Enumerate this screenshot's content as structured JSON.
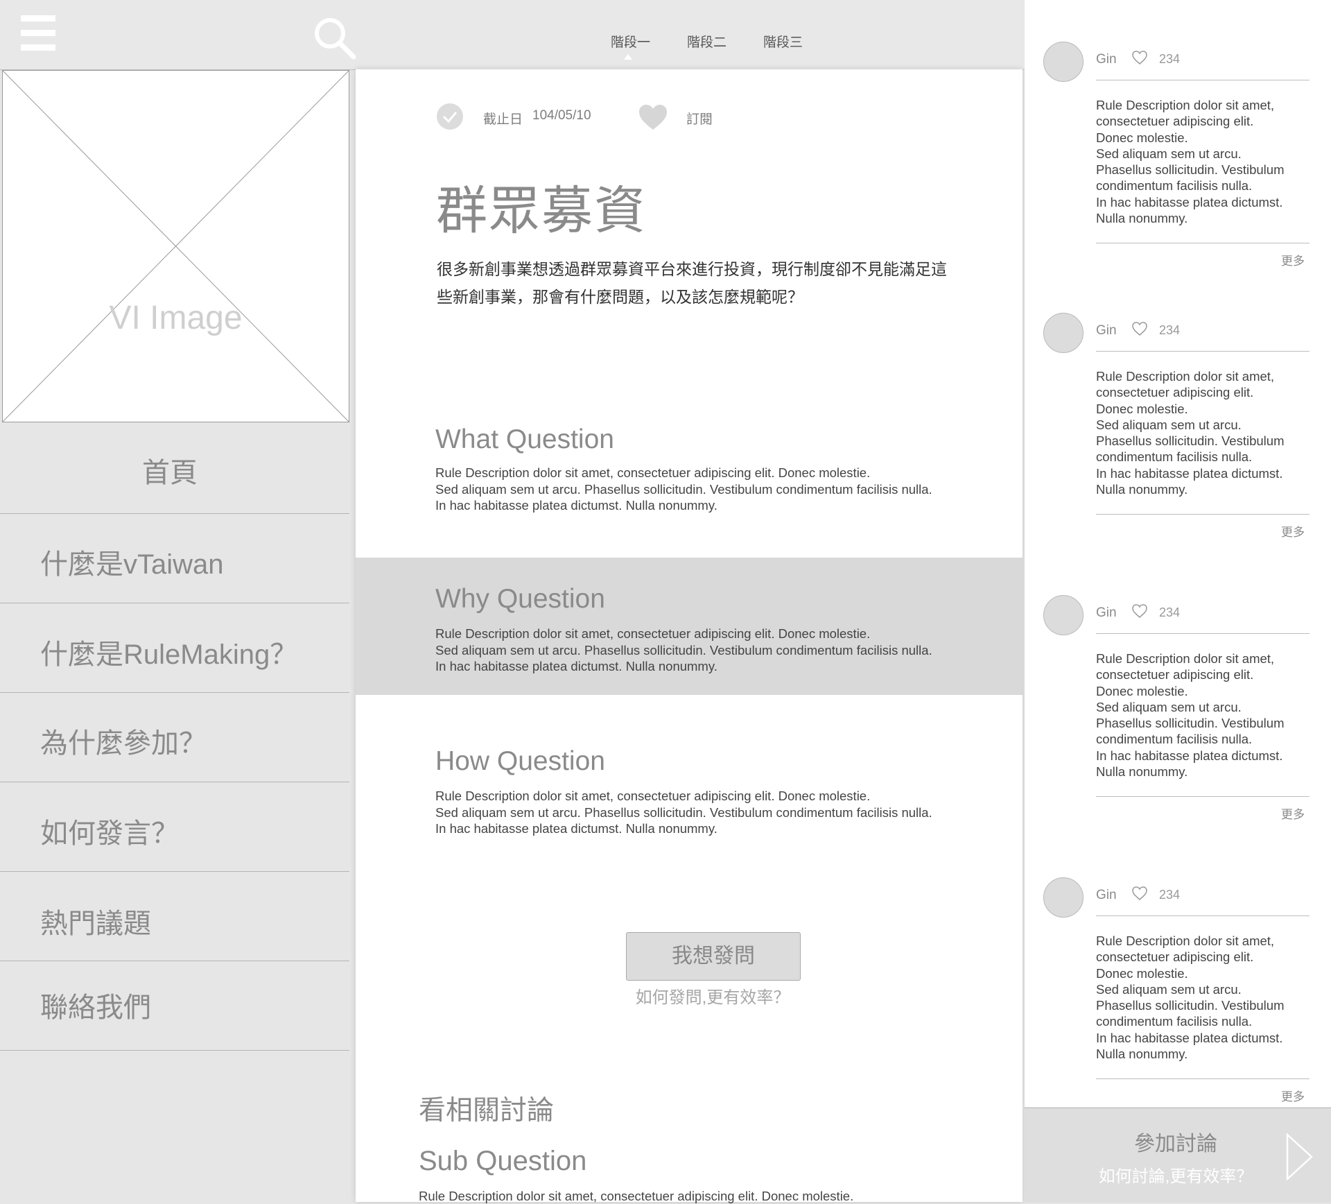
{
  "topbar": {
    "tabs": [
      "階段一",
      "階段二",
      "階段三"
    ]
  },
  "left": {
    "image_label": "VI  Image",
    "nav": [
      "首頁",
      "什麼是vTaiwan",
      "什麼是RuleMaking？",
      "為什麼參加？",
      "如何發言？",
      "熱門議題",
      "聯絡我們"
    ]
  },
  "main": {
    "deadline_label": "截止日",
    "deadline_value": "104/05/10",
    "subscribe_label": "訂閱",
    "title": "群眾募資",
    "intro_line1": "很多新創事業想透過群眾募資平台來進行投資，現行制度卻不見能滿足這",
    "intro_line2": "些新創事業，那會有什麼問題，以及該怎麼規範呢？",
    "sections": [
      {
        "title": "What Question",
        "lines": [
          "Rule Description dolor sit amet, consectetuer adipiscing elit. Donec molestie.",
          "Sed aliquam sem ut arcu. Phasellus sollicitudin. Vestibulum condimentum facilisis nulla.",
          "In hac habitasse platea dictumst. Nulla nonummy."
        ]
      },
      {
        "title": "Why Question",
        "lines": [
          "Rule Description dolor sit amet, consectetuer adipiscing elit. Donec molestie.",
          "Sed aliquam sem ut arcu. Phasellus sollicitudin. Vestibulum condimentum facilisis nulla.",
          "In hac habitasse platea dictumst. Nulla nonummy."
        ]
      },
      {
        "title": "How Question",
        "lines": [
          "Rule Description dolor sit amet, consectetuer adipiscing elit. Donec molestie.",
          "Sed aliquam sem ut arcu. Phasellus sollicitudin. Vestibulum condimentum facilisis nulla.",
          "In hac habitasse platea dictumst. Nulla nonummy."
        ]
      }
    ],
    "ask_button": "我想發問",
    "ask_hint": "如何發問,更有效率？",
    "related_title": "看相關討論",
    "sub_title": "Sub Question",
    "sub_body": "Rule Description dolor sit amet, consectetuer adipiscing elit. Donec molestie."
  },
  "comments": [
    {
      "name": "Gin",
      "likes": "234",
      "lines": [
        "Rule Description dolor sit amet,",
        "consectetuer adipiscing elit.",
        "Donec molestie.",
        "Sed aliquam sem ut arcu.",
        "Phasellus sollicitudin. Vestibulum",
        "condimentum facilisis nulla.",
        "In hac habitasse platea dictumst.",
        "Nulla nonummy."
      ],
      "more": "更多"
    },
    {
      "name": "Gin",
      "likes": "234",
      "lines": [
        "Rule Description dolor sit amet,",
        "consectetuer adipiscing elit.",
        "Donec molestie.",
        "Sed aliquam sem ut arcu.",
        "Phasellus sollicitudin. Vestibulum",
        "condimentum facilisis nulla.",
        "In hac habitasse platea dictumst.",
        "Nulla nonummy."
      ],
      "more": "更多"
    },
    {
      "name": "Gin",
      "likes": "234",
      "lines": [
        "Rule Description dolor sit amet,",
        "consectetuer adipiscing elit.",
        "Donec molestie.",
        "Sed aliquam sem ut arcu.",
        "Phasellus sollicitudin. Vestibulum",
        "condimentum facilisis nulla.",
        "In hac habitasse platea dictumst.",
        "Nulla nonummy."
      ],
      "more": "更多"
    },
    {
      "name": "Gin",
      "likes": "234",
      "lines": [
        "Rule Description dolor sit amet,",
        "consectetuer adipiscing elit.",
        "Donec molestie.",
        "Sed aliquam sem ut arcu.",
        "Phasellus sollicitudin. Vestibulum",
        "condimentum facilisis nulla.",
        "In hac habitasse platea dictumst.",
        "Nulla nonummy."
      ],
      "more": "更多"
    }
  ],
  "join": {
    "title": "參加討論",
    "hint": "如何討論,更有效率？"
  }
}
